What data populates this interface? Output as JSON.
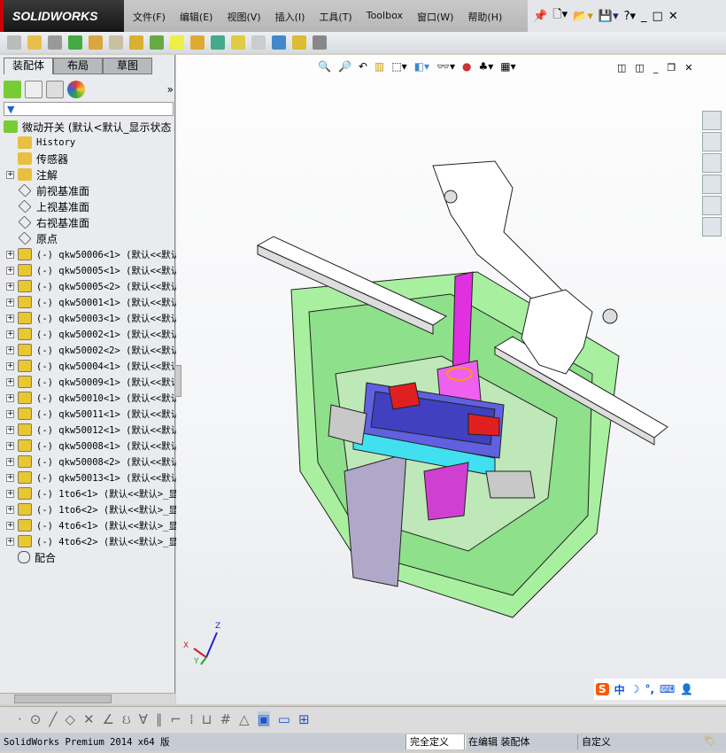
{
  "app": {
    "logo": "SOLIDWORKS"
  },
  "menu": [
    "文件(F)",
    "编辑(E)",
    "视图(V)",
    "插入(I)",
    "工具(T)",
    "Toolbox",
    "窗口(W)",
    "帮助(H)"
  ],
  "tabs": [
    "装配体",
    "布局",
    "草图"
  ],
  "tree": {
    "root": "微动开关  (默认<默认_显示状态",
    "items": [
      "History",
      "传感器",
      "注解",
      "前视基准面",
      "上视基准面",
      "右视基准面",
      "原点"
    ],
    "parts": [
      "(-) qkw50006<1> (默认<<默认",
      "(-) qkw50005<1> (默认<<默认",
      "(-) qkw50005<2> (默认<<默认",
      "(-) qkw50001<1> (默认<<默认",
      "(-) qkw50003<1> (默认<<默认",
      "(-) qkw50002<1> (默认<<默认",
      "(-) qkw50002<2> (默认<<默认",
      "(-) qkw50004<1> (默认<<默认",
      "(-) qkw50009<1> (默认<<默认",
      "(-) qkw50010<1> (默认<<默认",
      "(-) qkw50011<1> (默认<<默认",
      "(-) qkw50012<1> (默认<<默认",
      "(-) qkw50008<1> (默认<<默认",
      "(-) qkw50008<2> (默认<<默认",
      "(-) qkw50013<1> (默认<<默认",
      "(-) 1to6<1> (默认<<默认>_显",
      "(-) 1to6<2> (默认<<默认>_显",
      "(-) 4to6<1> (默认<<默认>_显",
      "(-) 4to6<2> (默认<<默认>_显"
    ],
    "mates": "配合"
  },
  "triad": {
    "x": "X",
    "y": "Y",
    "z": "Z"
  },
  "ime": "中",
  "status": {
    "version": "SolidWorks Premium 2014 x64 版",
    "defined": "完全定义",
    "editing": "在编辑 装配体",
    "custom": "自定义"
  }
}
